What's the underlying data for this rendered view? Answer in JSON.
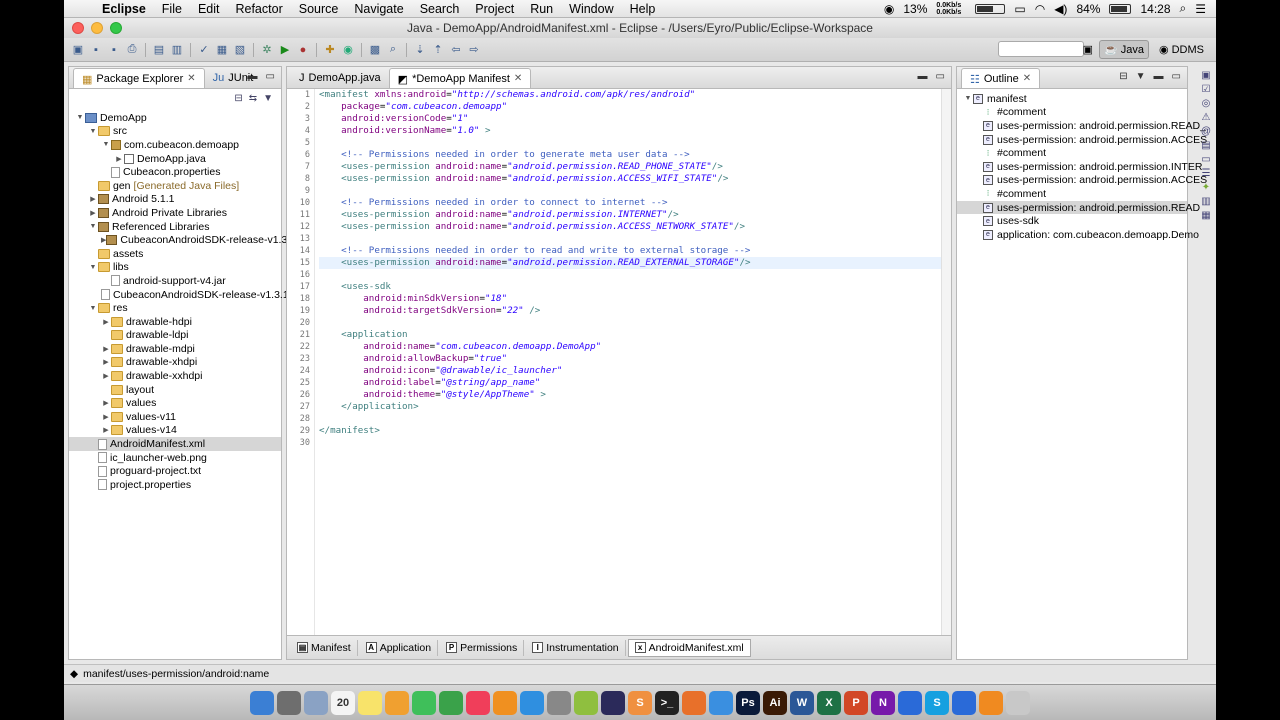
{
  "menubar": {
    "apple": "",
    "items": [
      "Eclipse",
      "File",
      "Edit",
      "Refactor",
      "Source",
      "Navigate",
      "Search",
      "Project",
      "Run",
      "Window",
      "Help"
    ],
    "battery_pct": "13%",
    "net_up": "0.0Kb/s",
    "net_down": "0.0Kb/s",
    "power": "84%",
    "clock": "14:28"
  },
  "window": {
    "title": "Java - DemoApp/AndroidManifest.xml - Eclipse - /Users/Eyro/Public/Eclipse-Workspace"
  },
  "perspectives": {
    "java": "Java",
    "ddms": "DDMS"
  },
  "explorer": {
    "tabs": [
      "Package Explorer",
      "JUnit"
    ],
    "tree": [
      {
        "label": "DemoApp",
        "indent": 0,
        "tw": "▼",
        "icon": "proj"
      },
      {
        "label": "src",
        "indent": 1,
        "tw": "▼",
        "icon": "folder"
      },
      {
        "label": "com.cubeacon.demoapp",
        "indent": 2,
        "tw": "▼",
        "icon": "pkg"
      },
      {
        "label": "DemoApp.java",
        "indent": 3,
        "tw": "▶",
        "icon": "jfile"
      },
      {
        "label": "Cubeacon.properties",
        "indent": 2,
        "tw": "",
        "icon": "xfile"
      },
      {
        "label": "gen",
        "extra": "[Generated Java Files]",
        "indent": 1,
        "tw": "",
        "icon": "folder"
      },
      {
        "label": "Android 5.1.1",
        "indent": 1,
        "tw": "▶",
        "icon": "lib"
      },
      {
        "label": "Android Private Libraries",
        "indent": 1,
        "tw": "▶",
        "icon": "lib"
      },
      {
        "label": "Referenced Libraries",
        "indent": 1,
        "tw": "▼",
        "icon": "lib"
      },
      {
        "label": "CubeaconAndroidSDK-release-v1.3.1",
        "indent": 2,
        "tw": "▶",
        "icon": "lib"
      },
      {
        "label": "assets",
        "indent": 1,
        "tw": "",
        "icon": "folder"
      },
      {
        "label": "libs",
        "indent": 1,
        "tw": "▼",
        "icon": "folder"
      },
      {
        "label": "android-support-v4.jar",
        "indent": 2,
        "tw": "",
        "icon": "xfile"
      },
      {
        "label": "CubeaconAndroidSDK-release-v1.3.1",
        "indent": 2,
        "tw": "",
        "icon": "xfile"
      },
      {
        "label": "res",
        "indent": 1,
        "tw": "▼",
        "icon": "folder"
      },
      {
        "label": "drawable-hdpi",
        "indent": 2,
        "tw": "▶",
        "icon": "folder"
      },
      {
        "label": "drawable-ldpi",
        "indent": 2,
        "tw": "",
        "icon": "folder"
      },
      {
        "label": "drawable-mdpi",
        "indent": 2,
        "tw": "▶",
        "icon": "folder"
      },
      {
        "label": "drawable-xhdpi",
        "indent": 2,
        "tw": "▶",
        "icon": "folder"
      },
      {
        "label": "drawable-xxhdpi",
        "indent": 2,
        "tw": "▶",
        "icon": "folder"
      },
      {
        "label": "layout",
        "indent": 2,
        "tw": "",
        "icon": "folder"
      },
      {
        "label": "values",
        "indent": 2,
        "tw": "▶",
        "icon": "folder"
      },
      {
        "label": "values-v11",
        "indent": 2,
        "tw": "▶",
        "icon": "folder"
      },
      {
        "label": "values-v14",
        "indent": 2,
        "tw": "▶",
        "icon": "folder"
      },
      {
        "label": "AndroidManifest.xml",
        "indent": 1,
        "tw": "",
        "icon": "xfile",
        "selected": true
      },
      {
        "label": "ic_launcher-web.png",
        "indent": 1,
        "tw": "",
        "icon": "xfile"
      },
      {
        "label": "proguard-project.txt",
        "indent": 1,
        "tw": "",
        "icon": "xfile"
      },
      {
        "label": "project.properties",
        "indent": 1,
        "tw": "",
        "icon": "xfile"
      }
    ]
  },
  "editor": {
    "tabs": [
      {
        "label": "DemoApp.java",
        "active": false
      },
      {
        "label": "*DemoApp Manifest",
        "active": true
      }
    ],
    "current_line": 15,
    "lines": [
      "<manifest xmlns:android=\"http://schemas.android.com/apk/res/android\"",
      "    package=\"com.cubeacon.demoapp\"",
      "    android:versionCode=\"1\"",
      "    android:versionName=\"1.0\" >",
      "",
      "    <!-- Permissions needed in order to generate meta user data -->",
      "    <uses-permission android:name=\"android.permission.READ_PHONE_STATE\"/>",
      "    <uses-permission android:name=\"android.permission.ACCESS_WIFI_STATE\"/>",
      "",
      "    <!-- Permissions needed in order to connect to internet -->",
      "    <uses-permission android:name=\"android.permission.INTERNET\"/>",
      "    <uses-permission android:name=\"android.permission.ACCESS_NETWORK_STATE\"/>",
      "",
      "    <!-- Permissions needed in order to read and write to external storage -->",
      "    <uses-permission android:name=\"android.permission.READ_EXTERNAL_STORAGE\"/>",
      "",
      "    <uses-sdk",
      "        android:minSdkVersion=\"18\"",
      "        android:targetSdkVersion=\"22\" />",
      "",
      "    <application",
      "        android:name=\"com.cubeacon.demoapp.DemoApp\"",
      "        android:allowBackup=\"true\"",
      "        android:icon=\"@drawable/ic_launcher\"",
      "        android:label=\"@string/app_name\"",
      "        android:theme=\"@style/AppTheme\" >",
      "    </application>",
      "",
      "</manifest>",
      ""
    ],
    "bottom_tabs": [
      {
        "label": "Manifest",
        "icon": "▤"
      },
      {
        "label": "Application",
        "icon": "A"
      },
      {
        "label": "Permissions",
        "icon": "P"
      },
      {
        "label": "Instrumentation",
        "icon": "I"
      },
      {
        "label": "AndroidManifest.xml",
        "icon": "x",
        "active": true
      }
    ]
  },
  "outline": {
    "tab": "Outline",
    "items": [
      {
        "label": "manifest",
        "indent": 0,
        "kind": "e",
        "tw": "▼"
      },
      {
        "label": "#comment",
        "indent": 1,
        "kind": "c"
      },
      {
        "label": "uses-permission: android.permission.READ_",
        "indent": 1,
        "kind": "e"
      },
      {
        "label": "uses-permission: android.permission.ACCES",
        "indent": 1,
        "kind": "e"
      },
      {
        "label": "#comment",
        "indent": 1,
        "kind": "c"
      },
      {
        "label": "uses-permission: android.permission.INTER",
        "indent": 1,
        "kind": "e"
      },
      {
        "label": "uses-permission: android.permission.ACCES",
        "indent": 1,
        "kind": "e"
      },
      {
        "label": "#comment",
        "indent": 1,
        "kind": "c"
      },
      {
        "label": "uses-permission: android.permission.READ",
        "indent": 1,
        "kind": "e",
        "selected": true
      },
      {
        "label": "uses-sdk",
        "indent": 1,
        "kind": "e"
      },
      {
        "label": "application: com.cubeacon.demoapp.Demo",
        "indent": 1,
        "kind": "e"
      }
    ]
  },
  "status": {
    "path": "manifest/uses-permission/android:name"
  },
  "dock": {
    "items": [
      {
        "name": "finder",
        "color": "#3b7fd4",
        "glyph": ""
      },
      {
        "name": "launchpad",
        "color": "#6e6e6e",
        "glyph": ""
      },
      {
        "name": "preview",
        "color": "#8aa2c4",
        "glyph": ""
      },
      {
        "name": "calendar",
        "color": "#f4f4f4",
        "glyph": "20"
      },
      {
        "name": "notes",
        "color": "#f8e36a",
        "glyph": ""
      },
      {
        "name": "photos",
        "color": "#f0a030",
        "glyph": ""
      },
      {
        "name": "messages",
        "color": "#3fbf5a",
        "glyph": ""
      },
      {
        "name": "facetime",
        "color": "#3aa24a",
        "glyph": ""
      },
      {
        "name": "music",
        "color": "#f03e5a",
        "glyph": ""
      },
      {
        "name": "books",
        "color": "#f09020",
        "glyph": ""
      },
      {
        "name": "appstore",
        "color": "#2f8fe0",
        "glyph": ""
      },
      {
        "name": "settings",
        "color": "#888",
        "glyph": ""
      },
      {
        "name": "android",
        "color": "#8fbf3f",
        "glyph": ""
      },
      {
        "name": "eclipse",
        "color": "#2b2a5a",
        "glyph": ""
      },
      {
        "name": "sublime",
        "color": "#f09040",
        "glyph": "S"
      },
      {
        "name": "terminal",
        "color": "#222",
        "glyph": ">_"
      },
      {
        "name": "firefox",
        "color": "#e8702a",
        "glyph": ""
      },
      {
        "name": "safari",
        "color": "#3a8fe0",
        "glyph": ""
      },
      {
        "name": "photoshop",
        "color": "#0a1a3a",
        "glyph": "Ps"
      },
      {
        "name": "illustrator",
        "color": "#3a1a05",
        "glyph": "Ai"
      },
      {
        "name": "word",
        "color": "#2b5797",
        "glyph": "W"
      },
      {
        "name": "excel",
        "color": "#1e7145",
        "glyph": "X"
      },
      {
        "name": "powerpoint",
        "color": "#d24726",
        "glyph": "P"
      },
      {
        "name": "onenote",
        "color": "#7719aa",
        "glyph": "N"
      },
      {
        "name": "onedrive",
        "color": "#2a6ad8",
        "glyph": ""
      },
      {
        "name": "skype",
        "color": "#16a0e0",
        "glyph": "S"
      },
      {
        "name": "vpn",
        "color": "#2a6ad8",
        "glyph": ""
      },
      {
        "name": "vlc",
        "color": "#f08a20",
        "glyph": ""
      },
      {
        "name": "trash",
        "color": "#c8c8c8",
        "glyph": ""
      }
    ]
  }
}
